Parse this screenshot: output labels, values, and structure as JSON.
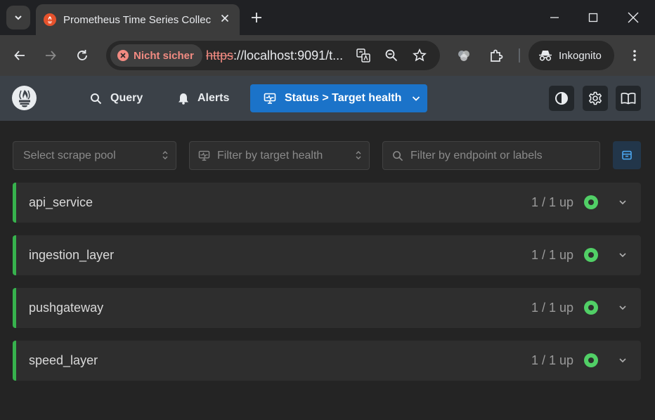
{
  "browser": {
    "tab_title": "Prometheus Time Series Collect",
    "security_label": "Nicht sicher",
    "url_scheme": "https",
    "url_rest": "://localhost:9091/t...",
    "profile_label": "Inkognito"
  },
  "nav": {
    "query_label": "Query",
    "alerts_label": "Alerts",
    "status_label": "Status > Target health"
  },
  "filters": {
    "scrape_pool_placeholder": "Select scrape pool",
    "health_placeholder": "Filter by target health",
    "labels_placeholder": "Filter by endpoint or labels"
  },
  "pools": [
    {
      "name": "api_service",
      "count": "1 / 1 up"
    },
    {
      "name": "ingestion_layer",
      "count": "1 / 1 up"
    },
    {
      "name": "pushgateway",
      "count": "1 / 1 up"
    },
    {
      "name": "speed_layer",
      "count": "1 / 1 up"
    }
  ],
  "colors": {
    "healthy": "#51cf66",
    "accent": "#1b73c9",
    "pool_border": "#37b24d"
  }
}
